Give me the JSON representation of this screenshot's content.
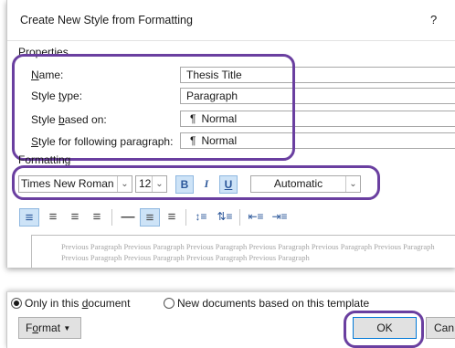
{
  "dialog": {
    "title": "Create New Style from Formatting",
    "help": "?"
  },
  "properties": {
    "heading": "Properties",
    "rows": [
      {
        "label_u": "N",
        "label_rest": "ame:",
        "value": "Thesis Title",
        "icon": ""
      },
      {
        "label_pre": "Style ",
        "label_u": "t",
        "label_rest": "ype:",
        "value": "Paragraph",
        "icon": ""
      },
      {
        "label_pre": "Style ",
        "label_u": "b",
        "label_rest": "ased on:",
        "value": "Normal",
        "icon": "¶"
      },
      {
        "label_u": "S",
        "label_rest": "tyle for following paragraph:",
        "value": "Normal",
        "icon": "¶"
      }
    ]
  },
  "formatting": {
    "heading": "Formatting",
    "font": "Times New Roman",
    "size": "12",
    "bold": "B",
    "italic": "I",
    "underline": "U",
    "color": "Automatic"
  },
  "preview_text": "Previous Paragraph Previous Paragraph Previous Paragraph Previous Paragraph Previous Paragraph Previous Paragraph Previous Paragraph Previous Paragraph Previous Paragraph Previous Paragraph",
  "scope": {
    "option1_pre": "Only in this ",
    "option1_u": "d",
    "option1_rest": "ocument",
    "option2": "New documents based on this template"
  },
  "buttons": {
    "format_u": "o",
    "format_pre": "F",
    "format_rest": "rmat",
    "ok": "OK",
    "cancel": "Can"
  },
  "highlight_color": "#6a3fa0"
}
